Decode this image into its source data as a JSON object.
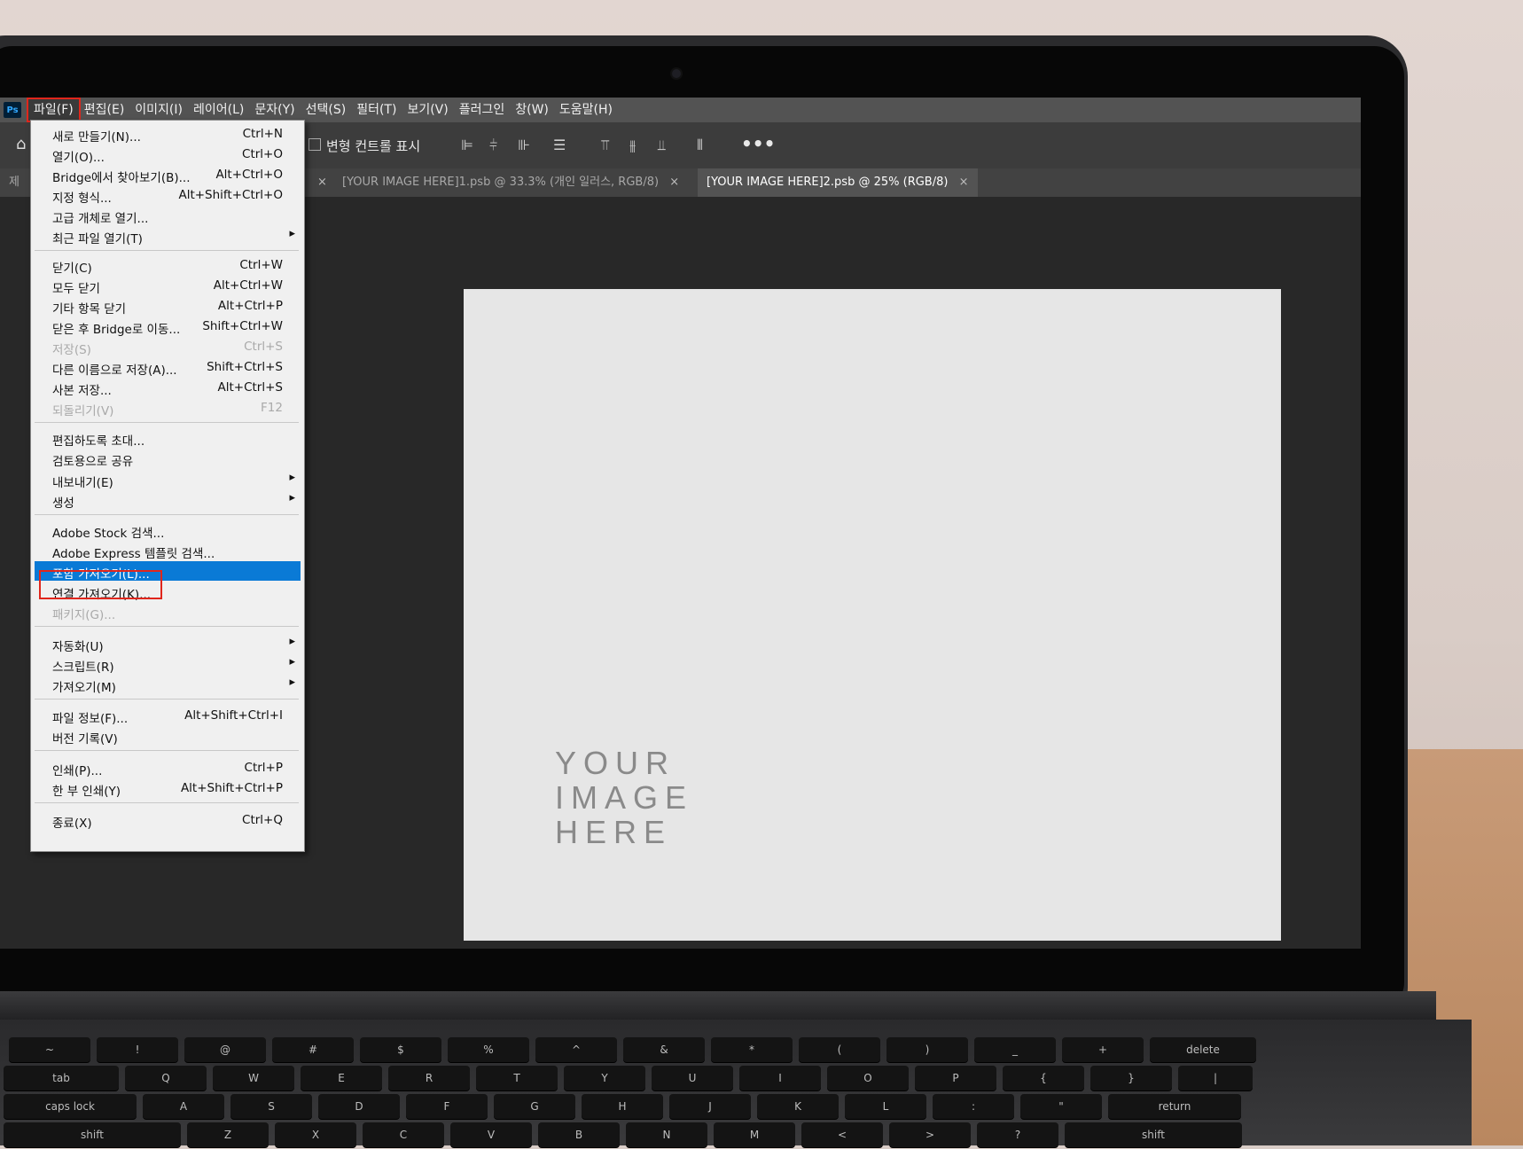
{
  "menubar": {
    "items": [
      "파일(F)",
      "편집(E)",
      "이미지(I)",
      "레이어(L)",
      "문자(Y)",
      "선택(S)",
      "필터(T)",
      "보기(V)",
      "플러그인",
      "창(W)",
      "도움말(H)"
    ]
  },
  "optionsbar": {
    "transform_controls_label": "변형 컨트롤 표시",
    "more_label": "•••"
  },
  "tabs": {
    "left_partial": "제",
    "tab1": "[YOUR IMAGE HERE]1.psb @ 33.3% (개인 일러스, RGB/8)",
    "tab2": "[YOUR IMAGE HERE]2.psb @ 25% (RGB/8)",
    "close": "×"
  },
  "canvas": {
    "line1": "YOUR",
    "line2": "IMAGE",
    "line3": "HERE"
  },
  "file_menu": {
    "new": {
      "label": "새로 만들기(N)...",
      "shortcut": "Ctrl+N"
    },
    "open": {
      "label": "열기(O)...",
      "shortcut": "Ctrl+O"
    },
    "bridge": {
      "label": "Bridge에서 찾아보기(B)...",
      "shortcut": "Alt+Ctrl+O"
    },
    "open_as": {
      "label": "지정 형식...",
      "shortcut": "Alt+Shift+Ctrl+O"
    },
    "smart": {
      "label": "고급 개체로 열기..."
    },
    "recent": {
      "label": "최근 파일 열기(T)"
    },
    "close": {
      "label": "닫기(C)",
      "shortcut": "Ctrl+W"
    },
    "close_all": {
      "label": "모두 닫기",
      "shortcut": "Alt+Ctrl+W"
    },
    "close_others": {
      "label": "기타 항목 닫기",
      "shortcut": "Alt+Ctrl+P"
    },
    "close_bridge": {
      "label": "닫은 후 Bridge로 이동...",
      "shortcut": "Shift+Ctrl+W"
    },
    "save": {
      "label": "저장(S)",
      "shortcut": "Ctrl+S"
    },
    "save_as": {
      "label": "다른 이름으로 저장(A)...",
      "shortcut": "Shift+Ctrl+S"
    },
    "save_copy": {
      "label": "사본 저장...",
      "shortcut": "Alt+Ctrl+S"
    },
    "revert": {
      "label": "되돌리기(V)",
      "shortcut": "F12"
    },
    "invite": {
      "label": "편집하도록 초대..."
    },
    "share": {
      "label": "검토용으로 공유"
    },
    "export": {
      "label": "내보내기(E)"
    },
    "generate": {
      "label": "생성"
    },
    "stock": {
      "label": "Adobe Stock 검색..."
    },
    "express": {
      "label": "Adobe Express 템플릿 검색..."
    },
    "place_embedded": {
      "label": "포함 가져오기(L)..."
    },
    "place_linked": {
      "label": "연결 가져오기(K)..."
    },
    "package": {
      "label": "패키지(G)..."
    },
    "automate": {
      "label": "자동화(U)"
    },
    "scripts": {
      "label": "스크립트(R)"
    },
    "import": {
      "label": "가져오기(M)"
    },
    "file_info": {
      "label": "파일 정보(F)...",
      "shortcut": "Alt+Shift+Ctrl+I"
    },
    "version_history": {
      "label": "버전 기록(V)"
    },
    "print": {
      "label": "인쇄(P)...",
      "shortcut": "Ctrl+P"
    },
    "print_one": {
      "label": "한 부 인쇄(Y)",
      "shortcut": "Alt+Shift+Ctrl+P"
    },
    "exit": {
      "label": "종료(X)",
      "shortcut": "Ctrl+Q"
    },
    "submenu_arrow": "▸"
  },
  "keyboard": {
    "row1": [
      "~",
      "!",
      "@",
      "#",
      "$",
      "%",
      "^",
      "&",
      "*",
      "(",
      ")",
      "_",
      "+",
      "delete"
    ],
    "row2": [
      "tab",
      "Q",
      "W",
      "E",
      "R",
      "T",
      "Y",
      "U",
      "I",
      "O",
      "P",
      "{",
      "}",
      "|"
    ],
    "row3": [
      "caps lock",
      "A",
      "S",
      "D",
      "F",
      "G",
      "H",
      "J",
      "K",
      "L",
      ":",
      "\"",
      "return"
    ],
    "row4": [
      "shift",
      "Z",
      "X",
      "C",
      "V",
      "B",
      "N",
      "M",
      "<",
      ">",
      "?",
      "shift"
    ]
  },
  "colors": {
    "highlight": "#0a7ad6",
    "annotation_red": "#e0261c",
    "menubar": "#535353",
    "workspace": "#282828",
    "canvas": "#e6e6e6"
  }
}
